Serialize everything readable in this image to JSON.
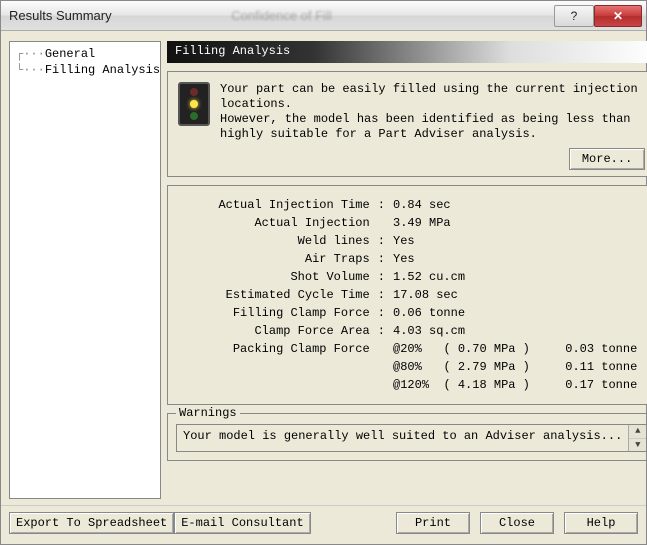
{
  "window": {
    "title": "Results Summary",
    "center_text": "Confidence of Fill"
  },
  "sidebar": {
    "items": [
      {
        "label": "General"
      },
      {
        "label": "Filling Analysis"
      }
    ]
  },
  "main": {
    "header": "Filling Analysis",
    "message": "Your part can be easily filled using the current injection locations.\nHowever, the model has been identified as being less than highly suitable for a Part Adviser analysis.",
    "more_label": "More...",
    "stats": {
      "rows": [
        {
          "label": "Actual Injection Time",
          "value": "0.84 sec"
        },
        {
          "label": "Actual Injection",
          "value": "3.49 MPa"
        },
        {
          "label": "Weld lines",
          "value": "Yes"
        },
        {
          "label": "Air Traps",
          "value": "Yes"
        },
        {
          "label": "Shot Volume",
          "value": "1.52 cu.cm"
        },
        {
          "label": "Estimated Cycle Time",
          "value": "17.08 sec"
        },
        {
          "label": "Filling Clamp Force",
          "value": "0.06 tonne"
        },
        {
          "label": "Clamp Force Area",
          "value": "4.03 sq.cm"
        }
      ],
      "packing_label": "Packing Clamp Force",
      "packing": [
        {
          "pct": "@20%",
          "mpa": "( 0.70 MPa )",
          "tonne": "0.03 tonne"
        },
        {
          "pct": "@80%",
          "mpa": "( 2.79 MPa )",
          "tonne": "0.11 tonne"
        },
        {
          "pct": "@120%",
          "mpa": "( 4.18 MPa )",
          "tonne": "0.17 tonne"
        }
      ]
    },
    "warnings": {
      "legend": "Warnings",
      "text": "Your model is generally well suited to an Adviser analysis..."
    }
  },
  "footer": {
    "export_label": "Export To Spreadsheet",
    "email_label": "E-mail Consultant",
    "print_label": "Print",
    "close_label": "Close",
    "help_label": "Help"
  }
}
